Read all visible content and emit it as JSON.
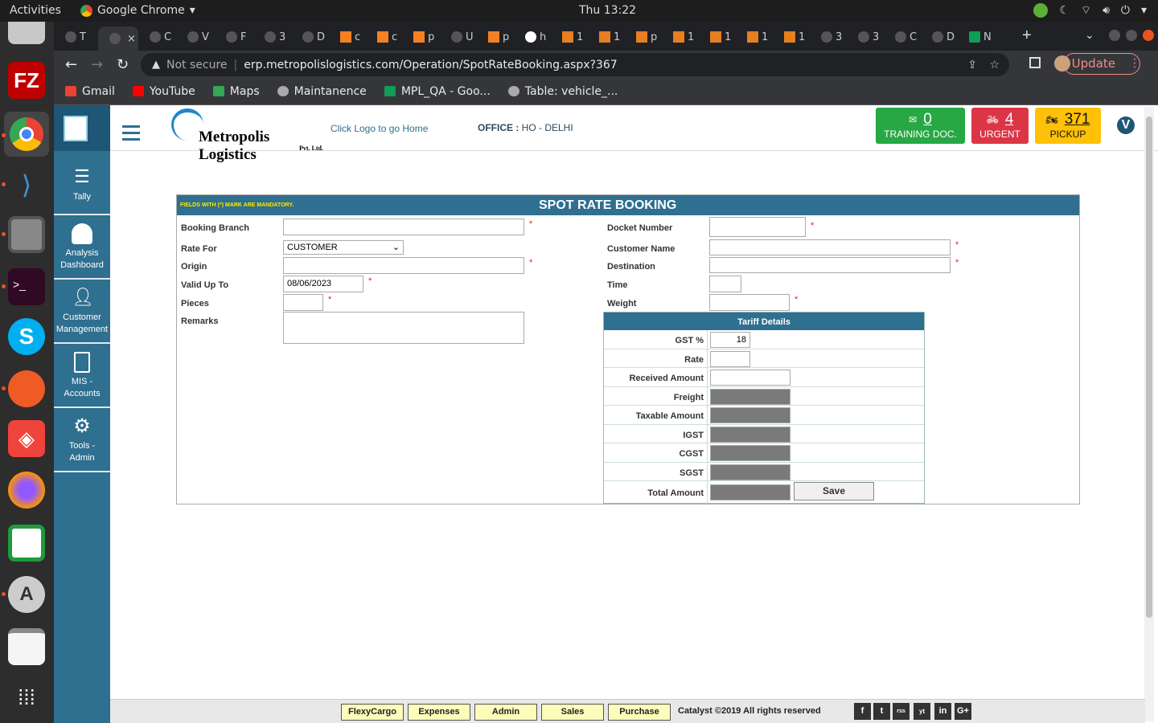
{
  "system": {
    "activities": "Activities",
    "app_name": "Google Chrome",
    "clock": "Thu 13:22"
  },
  "tabs": [
    {
      "icon": "globe-icon",
      "label": "T"
    },
    {
      "icon": "globe-icon",
      "label": "",
      "active": true
    },
    {
      "icon": "globe-icon",
      "label": "C"
    },
    {
      "icon": "globe-icon",
      "label": "V"
    },
    {
      "icon": "globe-icon",
      "label": "F"
    },
    {
      "icon": "generic-tab-icon",
      "label": "3"
    },
    {
      "icon": "generic-tab-icon",
      "label": "D"
    },
    {
      "icon": "stackoverflow-icon",
      "label": "c"
    },
    {
      "icon": "stackoverflow-icon",
      "label": "c"
    },
    {
      "icon": "stackoverflow-icon",
      "label": "p"
    },
    {
      "icon": "laptop-icon",
      "label": "U"
    },
    {
      "icon": "stackoverflow-icon",
      "label": "p"
    },
    {
      "icon": "google-icon",
      "label": "h"
    },
    {
      "icon": "warning-icon",
      "label": "1"
    },
    {
      "icon": "warning-icon",
      "label": "1"
    },
    {
      "icon": "warning-icon",
      "label": "p"
    },
    {
      "icon": "warning-icon",
      "label": "1"
    },
    {
      "icon": "warning-icon",
      "label": "1"
    },
    {
      "icon": "warning-icon",
      "label": "1"
    },
    {
      "icon": "warning-icon",
      "label": "1"
    },
    {
      "icon": "generic-tab-icon",
      "label": "3"
    },
    {
      "icon": "generic-tab-icon",
      "label": "3"
    },
    {
      "icon": "generic-tab-icon",
      "label": "C"
    },
    {
      "icon": "generic-tab-icon",
      "label": "D"
    },
    {
      "icon": "sheets-icon",
      "label": "N"
    }
  ],
  "toolbar": {
    "not_secure": "Not secure",
    "url": "erp.metropolislogistics.com/Operation/SpotRateBooking.aspx?367",
    "update_label": "Update"
  },
  "bookmarks": [
    {
      "label": "Gmail",
      "color": "#ea4335"
    },
    {
      "label": "YouTube",
      "color": "#ff0000"
    },
    {
      "label": "Maps",
      "color": "#34a853"
    },
    {
      "label": "Maintanence",
      "color": "#aaaaaa"
    },
    {
      "label": "MPL_QA - Goo...",
      "color": "#0f9d58"
    },
    {
      "label": "Table: vehicle_...",
      "color": "#aaaaaa"
    }
  ],
  "sidebar": {
    "items": [
      {
        "label1": "Tally",
        "label2": ""
      },
      {
        "label1": "Analysis",
        "label2": "Dashboard"
      },
      {
        "label1": "Customer",
        "label2": "Management"
      },
      {
        "label1": "MIS -",
        "label2": "Accounts"
      },
      {
        "label1": "Tools -",
        "label2": "Admin"
      }
    ]
  },
  "header": {
    "logo_text": "Metropolis Logistics",
    "logo_sub": "Pvt. Ltd.",
    "click_logo": "Click Logo to go Home",
    "office_label": "OFFICE :",
    "office_value": " HO - DELHI",
    "training_count": "0",
    "training_label": "TRAINING DOC.",
    "urgent_count": "4",
    "urgent_label": "URGENT",
    "pickup_count": "371",
    "pickup_label": "PICKUP",
    "avatar": "V",
    "colors": {
      "training": "#28a745",
      "urgent": "#dc3545",
      "pickup": "#ffc107"
    }
  },
  "form": {
    "mandatory_note": "FIELDS WITH (*) MARK ARE MANDATORY.",
    "title": "SPOT RATE BOOKING",
    "booking_branch_label": "Booking Branch",
    "booking_branch_value": "",
    "rate_for_label": "Rate For",
    "rate_for_value": "CUSTOMER",
    "origin_label": "Origin",
    "origin_value": "",
    "valid_up_to_label": "Valid Up To",
    "valid_up_to_value": "08/06/2023",
    "pieces_label": "Pieces",
    "pieces_value": "",
    "remarks_label": "Remarks",
    "remarks_value": "",
    "docket_number_label": "Docket Number",
    "docket_number_value": "",
    "customer_name_label": "Customer Name",
    "customer_name_value": "",
    "destination_label": "Destination",
    "destination_value": "",
    "time_label": "Time",
    "time_value": "",
    "weight_label": "Weight",
    "weight_value": "",
    "req": "*"
  },
  "tariff": {
    "title": "Tariff Details",
    "rows": [
      {
        "label": "GST %",
        "value": "18"
      },
      {
        "label": "Rate",
        "value": ""
      },
      {
        "label": "Received Amount",
        "value": ""
      },
      {
        "label": "Freight",
        "value": ""
      },
      {
        "label": "Taxable Amount",
        "value": ""
      },
      {
        "label": "IGST",
        "value": ""
      },
      {
        "label": "CGST",
        "value": ""
      },
      {
        "label": "SGST",
        "value": ""
      },
      {
        "label": "Total Amount",
        "value": ""
      }
    ],
    "save_label": "Save"
  },
  "footer": {
    "buttons": [
      "FlexyCargo",
      "Expenses",
      "Admin",
      "Sales",
      "Purchase"
    ],
    "copyright": "Catalyst  ©2019 All rights reserved",
    "social": [
      "f",
      "t",
      "rss",
      "yt",
      "in",
      "G+"
    ]
  }
}
